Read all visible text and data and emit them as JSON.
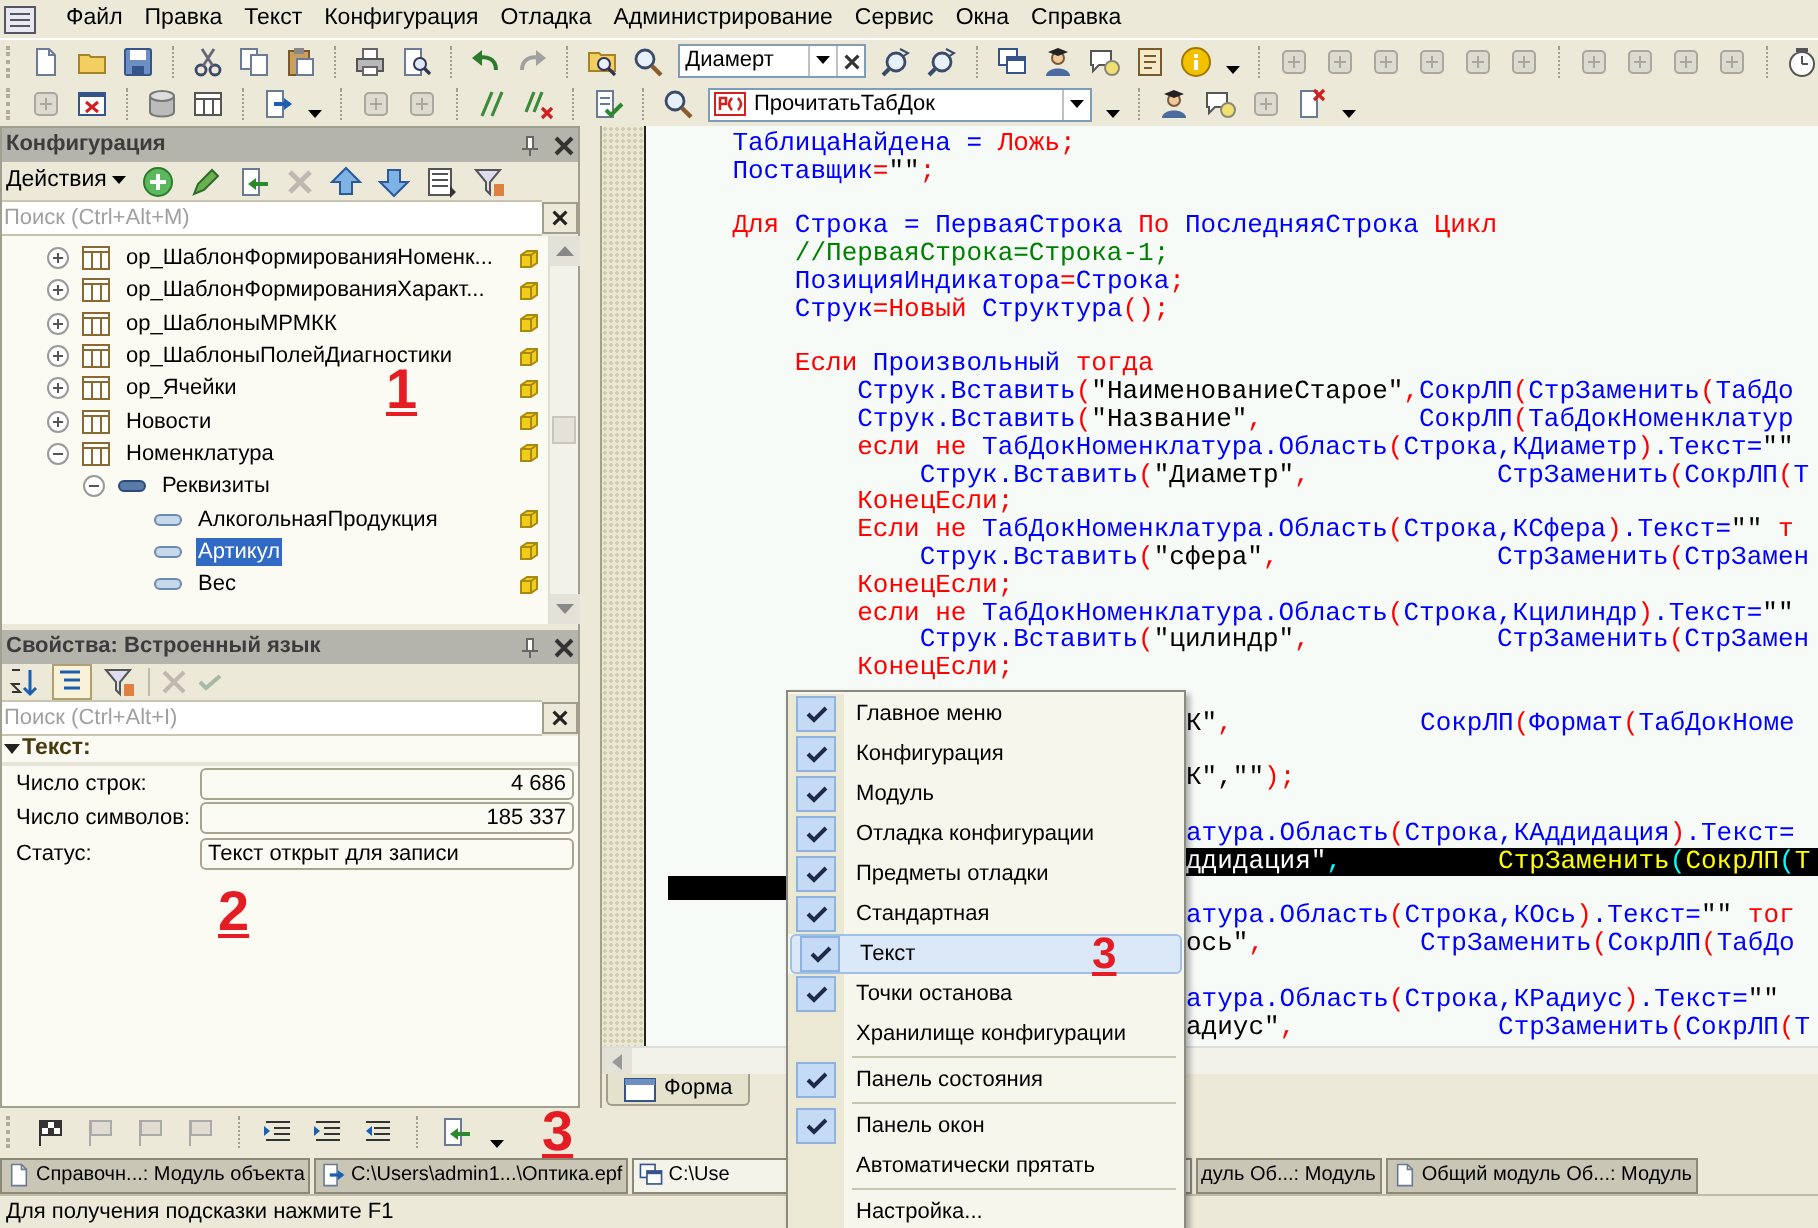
{
  "menu_bar": [
    "Файл",
    "Правка",
    "Текст",
    "Конфигурация",
    "Отладка",
    "Администрирование",
    "Сервис",
    "Окна",
    "Справка"
  ],
  "toolbar": {
    "search_combo": "Диамерт",
    "procedure_combo": "ПрочитатьТабДок"
  },
  "config_panel": {
    "title": "Конфигурация",
    "actions_label": "Действия",
    "search_placeholder": "Поиск (Ctrl+Alt+M)",
    "annotation": "1",
    "tree": [
      {
        "label": "ор_ШаблонФормированияНоменк...",
        "kind": "catalog",
        "expanded": false,
        "selected": false,
        "supported": true
      },
      {
        "label": "ор_ШаблонФормированияХаракт...",
        "kind": "catalog",
        "expanded": false,
        "selected": false,
        "supported": true
      },
      {
        "label": "ор_ШаблоныМРМКК",
        "kind": "catalog",
        "expanded": false,
        "selected": false,
        "supported": true
      },
      {
        "label": "ор_ШаблоныПолейДиагностики",
        "kind": "catalog",
        "expanded": false,
        "selected": false,
        "supported": true
      },
      {
        "label": "ор_Ячейки",
        "kind": "catalog",
        "expanded": false,
        "selected": false,
        "supported": true
      },
      {
        "label": "Новости",
        "kind": "catalog",
        "expanded": false,
        "selected": false,
        "supported": true
      },
      {
        "label": "Номенклатура",
        "kind": "catalog",
        "expanded": true,
        "selected": false,
        "supported": true,
        "children": [
          {
            "label": "Реквизиты",
            "kind": "group",
            "expanded": true,
            "selected": false,
            "supported": false,
            "children": [
              {
                "label": "АлкогольнаяПродукция",
                "kind": "attribute",
                "selected": false,
                "supported": true
              },
              {
                "label": "Артикул",
                "kind": "attribute",
                "selected": true,
                "supported": true
              },
              {
                "label": "Вес",
                "kind": "attribute",
                "selected": false,
                "supported": true
              }
            ]
          }
        ]
      }
    ]
  },
  "properties_panel": {
    "title": "Свойства: Встроенный язык",
    "search_placeholder": "Поиск (Ctrl+Alt+I)",
    "annotation": "2",
    "section": {
      "label": "Текст:",
      "expanded": true,
      "rows": [
        {
          "label": "Число строк:",
          "value": "4 686",
          "kind": "number"
        },
        {
          "label": "Число символов:",
          "value": "185 337",
          "kind": "number"
        },
        {
          "label": "Статус:",
          "value": "Текст открыт для записи",
          "kind": "text"
        }
      ]
    }
  },
  "editor": {
    "tabs": [
      {
        "label": "Форма",
        "selected": false
      }
    ],
    "lines": [
      {
        "kind": "code",
        "highlighted": false,
        "tokens": [
          {
            "kind": "identifier",
            "text": "    ТаблицаНайдена = "
          },
          {
            "kind": "keyword",
            "text": "Ложь;"
          }
        ]
      },
      {
        "kind": "code",
        "highlighted": false,
        "tokens": [
          {
            "kind": "identifier",
            "text": "    Поставщик"
          },
          {
            "kind": "operator",
            "text": "="
          },
          {
            "kind": "string",
            "text": "\"\""
          },
          {
            "kind": "operator",
            "text": ";"
          }
        ]
      },
      {
        "kind": "blank"
      },
      {
        "kind": "code",
        "highlighted": false,
        "tokens": [
          {
            "kind": "keyword",
            "text": "    Для "
          },
          {
            "kind": "identifier",
            "text": "Строка = ПерваяСтрока "
          },
          {
            "kind": "keyword",
            "text": "По "
          },
          {
            "kind": "identifier",
            "text": "ПоследняяСтрока "
          },
          {
            "kind": "keyword",
            "text": "Цикл"
          }
        ]
      },
      {
        "kind": "code",
        "highlighted": false,
        "tokens": [
          {
            "kind": "comment",
            "text": "        //ПерваяСтрока=Строка-1;"
          }
        ]
      },
      {
        "kind": "code",
        "highlighted": false,
        "tokens": [
          {
            "kind": "identifier",
            "text": "        ПозицияИндикатора"
          },
          {
            "kind": "operator",
            "text": "="
          },
          {
            "kind": "identifier",
            "text": "Строка"
          },
          {
            "kind": "operator",
            "text": ";"
          }
        ]
      },
      {
        "kind": "code",
        "highlighted": false,
        "tokens": [
          {
            "kind": "identifier",
            "text": "        Струк"
          },
          {
            "kind": "operator",
            "text": "="
          },
          {
            "kind": "keyword",
            "text": "Новый "
          },
          {
            "kind": "identifier",
            "text": "Структура"
          },
          {
            "kind": "operator",
            "text": "();"
          }
        ]
      },
      {
        "kind": "blank"
      },
      {
        "kind": "code",
        "highlighted": false,
        "tokens": [
          {
            "kind": "keyword",
            "text": "        Если "
          },
          {
            "kind": "identifier",
            "text": "Произвольный "
          },
          {
            "kind": "keyword",
            "text": "тогда"
          }
        ]
      },
      {
        "kind": "code",
        "highlighted": false,
        "tokens": [
          {
            "kind": "identifier",
            "text": "            Струк.Вставить"
          },
          {
            "kind": "operator",
            "text": "("
          },
          {
            "kind": "string",
            "text": "\"НаименованиеСтарое\""
          },
          {
            "kind": "operator",
            "text": ","
          },
          {
            "kind": "identifier",
            "text": "СокрЛП"
          },
          {
            "kind": "operator",
            "text": "("
          },
          {
            "kind": "identifier",
            "text": "СтрЗаменить"
          },
          {
            "kind": "operator",
            "text": "("
          },
          {
            "kind": "identifier",
            "text": "ТабДо"
          }
        ]
      },
      {
        "kind": "code",
        "highlighted": false,
        "tokens": [
          {
            "kind": "identifier",
            "text": "            Струк.Вставить"
          },
          {
            "kind": "operator",
            "text": "("
          },
          {
            "kind": "string",
            "text": "\"Название\""
          },
          {
            "kind": "operator",
            "text": ",          "
          },
          {
            "kind": "identifier",
            "text": "СокрЛП"
          },
          {
            "kind": "operator",
            "text": "("
          },
          {
            "kind": "identifier",
            "text": "ТабДокНоменклатур"
          }
        ]
      },
      {
        "kind": "code",
        "highlighted": false,
        "tokens": [
          {
            "kind": "keyword",
            "text": "            если не "
          },
          {
            "kind": "identifier",
            "text": "ТабДокНоменклатура.Область"
          },
          {
            "kind": "operator",
            "text": "("
          },
          {
            "kind": "identifier",
            "text": "Строка,КДиаметр"
          },
          {
            "kind": "operator",
            "text": ")"
          },
          {
            "kind": "identifier",
            "text": ".Текст="
          },
          {
            "kind": "string",
            "text": "\"\""
          }
        ]
      },
      {
        "kind": "code",
        "highlighted": false,
        "tokens": [
          {
            "kind": "identifier",
            "text": "                Струк.Вставить"
          },
          {
            "kind": "operator",
            "text": "("
          },
          {
            "kind": "string",
            "text": "\"Диаметр\""
          },
          {
            "kind": "operator",
            "text": ",            "
          },
          {
            "kind": "identifier",
            "text": "СтрЗаменить"
          },
          {
            "kind": "operator",
            "text": "("
          },
          {
            "kind": "identifier",
            "text": "СокрЛП"
          },
          {
            "kind": "operator",
            "text": "("
          },
          {
            "kind": "identifier",
            "text": "Т"
          }
        ]
      },
      {
        "kind": "code",
        "highlighted": false,
        "tokens": [
          {
            "kind": "keyword",
            "text": "            КонецЕсли;"
          }
        ]
      },
      {
        "kind": "code",
        "highlighted": false,
        "tokens": [
          {
            "kind": "keyword",
            "text": "            Если не "
          },
          {
            "kind": "identifier",
            "text": "ТабДокНоменклатура.Область"
          },
          {
            "kind": "operator",
            "text": "("
          },
          {
            "kind": "identifier",
            "text": "Строка,КСфера"
          },
          {
            "kind": "operator",
            "text": ")"
          },
          {
            "kind": "identifier",
            "text": ".Текст="
          },
          {
            "kind": "string",
            "text": "\"\" "
          },
          {
            "kind": "keyword",
            "text": "т"
          }
        ]
      },
      {
        "kind": "code",
        "highlighted": false,
        "tokens": [
          {
            "kind": "identifier",
            "text": "                Струк.Вставить"
          },
          {
            "kind": "operator",
            "text": "("
          },
          {
            "kind": "string",
            "text": "\"сфера\""
          },
          {
            "kind": "operator",
            "text": ",              "
          },
          {
            "kind": "identifier",
            "text": "СтрЗаменить"
          },
          {
            "kind": "operator",
            "text": "("
          },
          {
            "kind": "identifier",
            "text": "СтрЗамен"
          }
        ]
      },
      {
        "kind": "code",
        "highlighted": false,
        "tokens": [
          {
            "kind": "keyword",
            "text": "            КонецЕсли;"
          }
        ]
      },
      {
        "kind": "code",
        "highlighted": false,
        "tokens": [
          {
            "kind": "keyword",
            "text": "            если не "
          },
          {
            "kind": "identifier",
            "text": "ТабДокНоменклатура.Область"
          },
          {
            "kind": "operator",
            "text": "("
          },
          {
            "kind": "identifier",
            "text": "Строка,Кцилиндр"
          },
          {
            "kind": "operator",
            "text": ")"
          },
          {
            "kind": "identifier",
            "text": ".Текст="
          },
          {
            "kind": "string",
            "text": "\"\""
          }
        ]
      },
      {
        "kind": "code",
        "highlighted": false,
        "tokens": [
          {
            "kind": "identifier",
            "text": "                Струк.Вставить"
          },
          {
            "kind": "operator",
            "text": "("
          },
          {
            "kind": "string",
            "text": "\"цилиндр\""
          },
          {
            "kind": "operator",
            "text": ",            "
          },
          {
            "kind": "identifier",
            "text": "СтрЗаменить"
          },
          {
            "kind": "operator",
            "text": "("
          },
          {
            "kind": "identifier",
            "text": "СтрЗамен"
          }
        ]
      },
      {
        "kind": "code",
        "highlighted": false,
        "tokens": [
          {
            "kind": "keyword",
            "text": "            КонецЕсли;"
          }
        ]
      },
      {
        "kind": "blank"
      }
    ],
    "lines_beside_menu": [
      {
        "kind": "code",
        "highlighted": false,
        "tokens": [
          {
            "kind": "string",
            "text": "К\""
          },
          {
            "kind": "operator",
            "text": ",            "
          },
          {
            "kind": "identifier",
            "text": "СокрЛП"
          },
          {
            "kind": "operator",
            "text": "("
          },
          {
            "kind": "identifier",
            "text": "Формат"
          },
          {
            "kind": "operator",
            "text": "("
          },
          {
            "kind": "identifier",
            "text": "ТабДокНоме"
          }
        ]
      },
      {
        "kind": "blank"
      },
      {
        "kind": "code",
        "highlighted": false,
        "tokens": [
          {
            "kind": "string",
            "text": "К\",\"\""
          },
          {
            "kind": "operator",
            "text": ");"
          }
        ]
      },
      {
        "kind": "blank"
      },
      {
        "kind": "code",
        "highlighted": false,
        "tokens": [
          {
            "kind": "identifier",
            "text": "атура.Область"
          },
          {
            "kind": "operator",
            "text": "("
          },
          {
            "kind": "identifier",
            "text": "Строка,КАддидация"
          },
          {
            "kind": "operator",
            "text": ")"
          },
          {
            "kind": "identifier",
            "text": ".Текст="
          }
        ]
      },
      {
        "kind": "code",
        "highlighted": true,
        "tokens": [
          {
            "kind": "string",
            "text": "ддидация\""
          },
          {
            "kind": "operator",
            "text": ",          "
          },
          {
            "kind": "identifier",
            "text": "СтрЗаменить"
          },
          {
            "kind": "operator",
            "text": "("
          },
          {
            "kind": "identifier",
            "text": "СокрЛП"
          },
          {
            "kind": "operator",
            "text": "("
          },
          {
            "kind": "identifier",
            "text": "Т"
          }
        ]
      },
      {
        "kind": "blank"
      },
      {
        "kind": "code",
        "highlighted": false,
        "tokens": [
          {
            "kind": "identifier",
            "text": "атура.Область"
          },
          {
            "kind": "operator",
            "text": "("
          },
          {
            "kind": "identifier",
            "text": "Строка,КОсь"
          },
          {
            "kind": "operator",
            "text": ")"
          },
          {
            "kind": "identifier",
            "text": ".Текст="
          },
          {
            "kind": "string",
            "text": "\"\" "
          },
          {
            "kind": "keyword",
            "text": "тог"
          }
        ]
      },
      {
        "kind": "code",
        "highlighted": false,
        "tokens": [
          {
            "kind": "string",
            "text": "ось\""
          },
          {
            "kind": "operator",
            "text": ",          "
          },
          {
            "kind": "identifier",
            "text": "СтрЗаменить"
          },
          {
            "kind": "operator",
            "text": "("
          },
          {
            "kind": "identifier",
            "text": "СокрЛП"
          },
          {
            "kind": "operator",
            "text": "("
          },
          {
            "kind": "identifier",
            "text": "ТабДо"
          }
        ]
      },
      {
        "kind": "blank"
      },
      {
        "kind": "code",
        "highlighted": false,
        "tokens": [
          {
            "kind": "identifier",
            "text": "атура.Область"
          },
          {
            "kind": "operator",
            "text": "("
          },
          {
            "kind": "identifier",
            "text": "Строка,КРадиус"
          },
          {
            "kind": "operator",
            "text": ")"
          },
          {
            "kind": "identifier",
            "text": ".Текст="
          },
          {
            "kind": "string",
            "text": "\"\""
          }
        ]
      },
      {
        "kind": "code",
        "highlighted": false,
        "tokens": [
          {
            "kind": "string",
            "text": "адиус\""
          },
          {
            "kind": "operator",
            "text": ",             "
          },
          {
            "kind": "identifier",
            "text": "СтрЗаменить"
          },
          {
            "kind": "operator",
            "text": "("
          },
          {
            "kind": "identifier",
            "text": "СокрЛП"
          },
          {
            "kind": "operator",
            "text": "("
          },
          {
            "kind": "identifier",
            "text": "Т"
          }
        ]
      }
    ]
  },
  "context_menu": {
    "annotation": "3",
    "items": [
      {
        "kind": "item",
        "label": "Главное меню",
        "checked": true,
        "selected": false
      },
      {
        "kind": "item",
        "label": "Конфигурация",
        "checked": true,
        "selected": false
      },
      {
        "kind": "item",
        "label": "Модуль",
        "checked": true,
        "selected": false
      },
      {
        "kind": "item",
        "label": "Отладка конфигурации",
        "checked": true,
        "selected": false
      },
      {
        "kind": "item",
        "label": "Предметы отладки",
        "checked": true,
        "selected": false
      },
      {
        "kind": "item",
        "label": "Стандартная",
        "checked": true,
        "selected": false
      },
      {
        "kind": "item",
        "label": "Текст",
        "checked": true,
        "selected": true
      },
      {
        "kind": "item",
        "label": "Точки останова",
        "checked": true,
        "selected": false
      },
      {
        "kind": "item",
        "label": "Хранилище конфигурации",
        "checked": false,
        "selected": false
      },
      {
        "kind": "separator"
      },
      {
        "kind": "item",
        "label": "Панель состояния",
        "checked": true,
        "selected": false
      },
      {
        "kind": "separator"
      },
      {
        "kind": "item",
        "label": "Панель окон",
        "checked": true,
        "selected": false
      },
      {
        "kind": "item",
        "label": "Автоматически прятать",
        "checked": false,
        "selected": false
      },
      {
        "kind": "separator"
      },
      {
        "kind": "item",
        "label": "Настройка...",
        "checked": false,
        "selected": false
      }
    ]
  },
  "bottom_toolbar": {
    "annotation": "3"
  },
  "taskbar": [
    {
      "label": "Справочн...: Модуль объекта",
      "selected": false
    },
    {
      "label": "C:\\Users\\admin1...\\Оптика.epf",
      "selected": false
    },
    {
      "label": "C:\\Use",
      "selected": true
    },
    {
      "label": "дуль Об...: Модуль",
      "selected": false
    },
    {
      "label": "Общий модуль Об...: Модуль",
      "selected": false
    }
  ],
  "status_bar": "Для получения подсказки нажмите F1"
}
